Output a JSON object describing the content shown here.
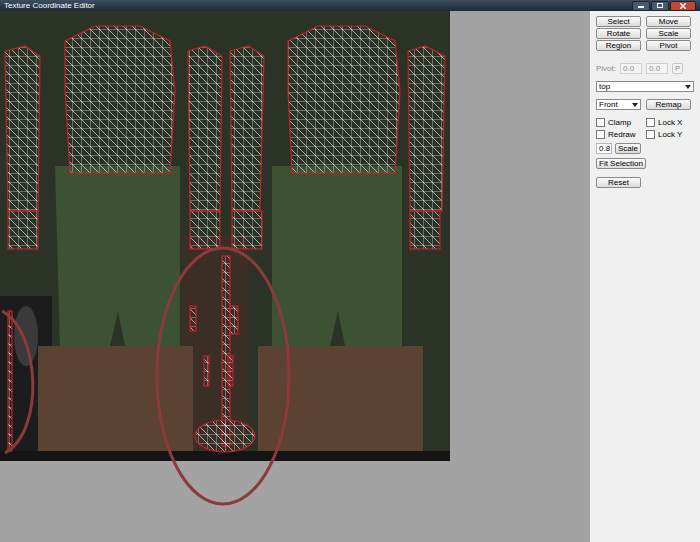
{
  "window": {
    "title": "Texture Coordinate Editor"
  },
  "tools": [
    {
      "label": "Select"
    },
    {
      "label": "Move"
    },
    {
      "label": "Rotate"
    },
    {
      "label": "Scale"
    },
    {
      "label": "Region"
    },
    {
      "label": "Pivot"
    }
  ],
  "pivot": {
    "label": "Pivot:",
    "x": "0.0",
    "y": "0.0",
    "button": "P",
    "disabled": true
  },
  "group_dropdown": {
    "value": "top"
  },
  "view_dropdown": {
    "value": "Front"
  },
  "remap_button": "Remap",
  "checkboxes": [
    {
      "label": "Clamp",
      "checked": false
    },
    {
      "label": "Lock X",
      "checked": false
    },
    {
      "label": "Redraw",
      "checked": false
    },
    {
      "label": "Lock Y",
      "checked": false
    }
  ],
  "scale": {
    "value": "0.8",
    "button": "Scale"
  },
  "fit_button": "Fit Selection",
  "reset_button": "Reset"
}
